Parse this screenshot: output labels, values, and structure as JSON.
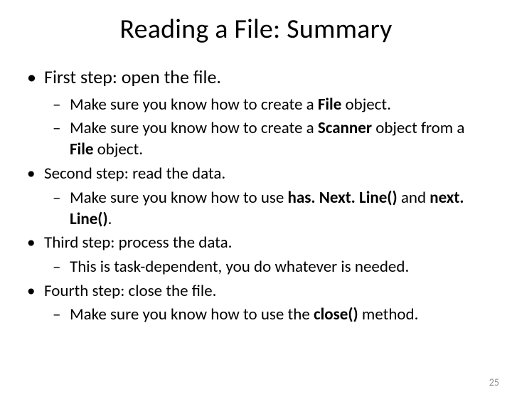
{
  "title": "Reading a File: Summary",
  "b1": "First step: open the file.",
  "b1s1_a": "Make sure you know how to create a ",
  "b1s1_b": "File",
  "b1s1_c": " object.",
  "b1s2_a": "Make sure you know how to create a ",
  "b1s2_b": "Scanner",
  "b1s2_c": " object from a ",
  "b1s2_d": "File",
  "b1s2_e": " object.",
  "b2": "Second step: read the data.",
  "b2s1_a": "Make sure you know how to use ",
  "b2s1_b": "has. Next. Line()",
  "b2s1_c": " and ",
  "b2s1_d": "next. Line()",
  "b2s1_e": ".",
  "b3": "Third step: process the data.",
  "b3s1": "This is task-dependent, you do whatever is needed.",
  "b4": "Fourth step: close the file.",
  "b4s1_a": "Make sure you know how to use the ",
  "b4s1_b": "close()",
  "b4s1_c": " method.",
  "page": "25"
}
